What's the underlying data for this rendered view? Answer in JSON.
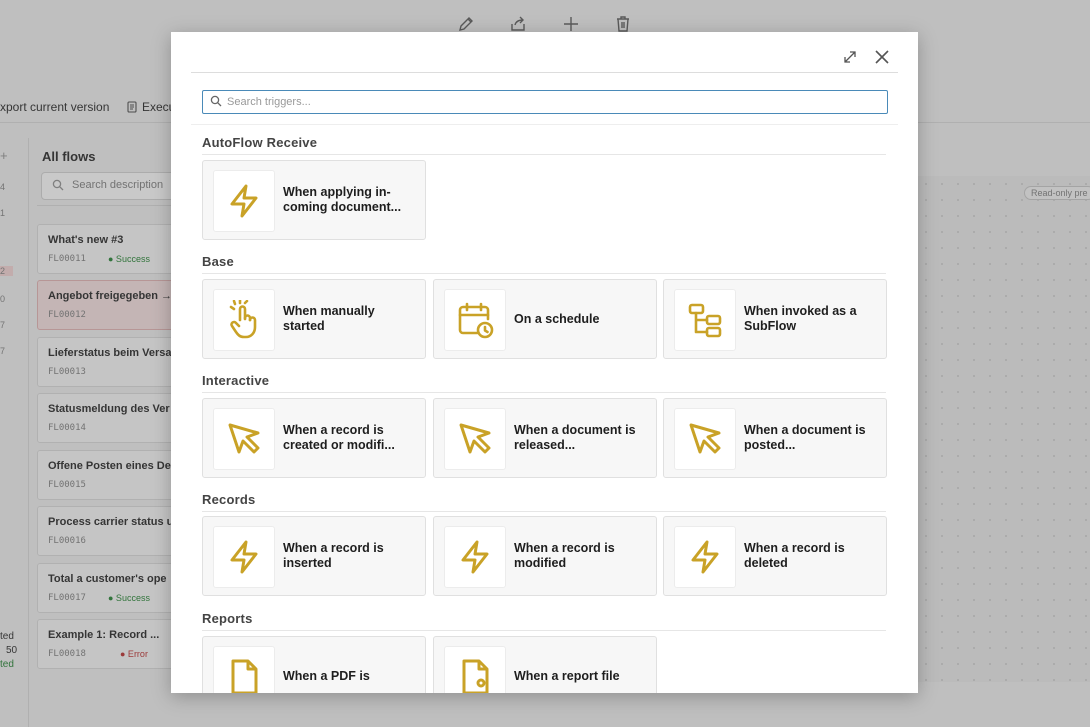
{
  "background": {
    "action_bar": {
      "export_label": "xport current version",
      "execute_label": "Execu"
    },
    "left_rail": {
      "numbers": [
        "4",
        "1",
        "2",
        "0",
        "7",
        "7"
      ]
    },
    "flows_panel": {
      "title": "All flows",
      "search_placeholder": "Search description",
      "items": [
        {
          "name": "What's new #3",
          "id": "FL00011",
          "status": "● Success",
          "suffix": "#"
        },
        {
          "name": "Angebot freigegeben →",
          "id": "FL00012",
          "status": "",
          "suffix": ""
        },
        {
          "name": "Lieferstatus beim Versa",
          "id": "FL00013",
          "status": "",
          "suffix": ""
        },
        {
          "name": "Statusmeldung des Ver",
          "id": "FL00014",
          "status": "",
          "suffix": ""
        },
        {
          "name": "Offene Posten eines De",
          "id": "FL00015",
          "status": "",
          "suffix": ""
        },
        {
          "name": "Process carrier status u",
          "id": "FL00016",
          "status": "",
          "suffix": ""
        },
        {
          "name": "Total a customer's ope",
          "id": "FL00017",
          "status": "● Success",
          "suffix": "#"
        },
        {
          "name": "Example 1: Record ...",
          "id": "FL00018",
          "status": "● Error",
          "suffix": "#"
        }
      ],
      "footer": [
        "ted",
        "50",
        "ted"
      ]
    },
    "canvas": {
      "badge": "Read-only pre"
    }
  },
  "modal": {
    "search_placeholder": "Search triggers...",
    "icon_color": "#c9a227",
    "sections": [
      {
        "title": "AutoFlow Receive",
        "cards": [
          {
            "label": "When applying in-coming document...",
            "icon": "lightning-icon"
          }
        ]
      },
      {
        "title": "Base",
        "cards": [
          {
            "label": "When manually started",
            "icon": "hand-pointer-icon"
          },
          {
            "label": "On a schedule",
            "icon": "calendar-clock-icon"
          },
          {
            "label": "When invoked as a SubFlow",
            "icon": "subflow-icon"
          }
        ]
      },
      {
        "title": "Interactive",
        "cards": [
          {
            "label": "When a record is created or modifi...",
            "icon": "cursor-icon"
          },
          {
            "label": "When a document is released...",
            "icon": "cursor-icon"
          },
          {
            "label": "When a document is posted...",
            "icon": "cursor-icon"
          }
        ]
      },
      {
        "title": "Records",
        "cards": [
          {
            "label": "When a record is inserted",
            "icon": "lightning-icon"
          },
          {
            "label": "When a record is modified",
            "icon": "lightning-icon"
          },
          {
            "label": "When a record is deleted",
            "icon": "lightning-icon"
          }
        ]
      },
      {
        "title": "Reports",
        "cards": [
          {
            "label": "When a PDF is",
            "icon": "document-icon"
          },
          {
            "label": "When a report file",
            "icon": "document-icon"
          }
        ]
      }
    ]
  }
}
